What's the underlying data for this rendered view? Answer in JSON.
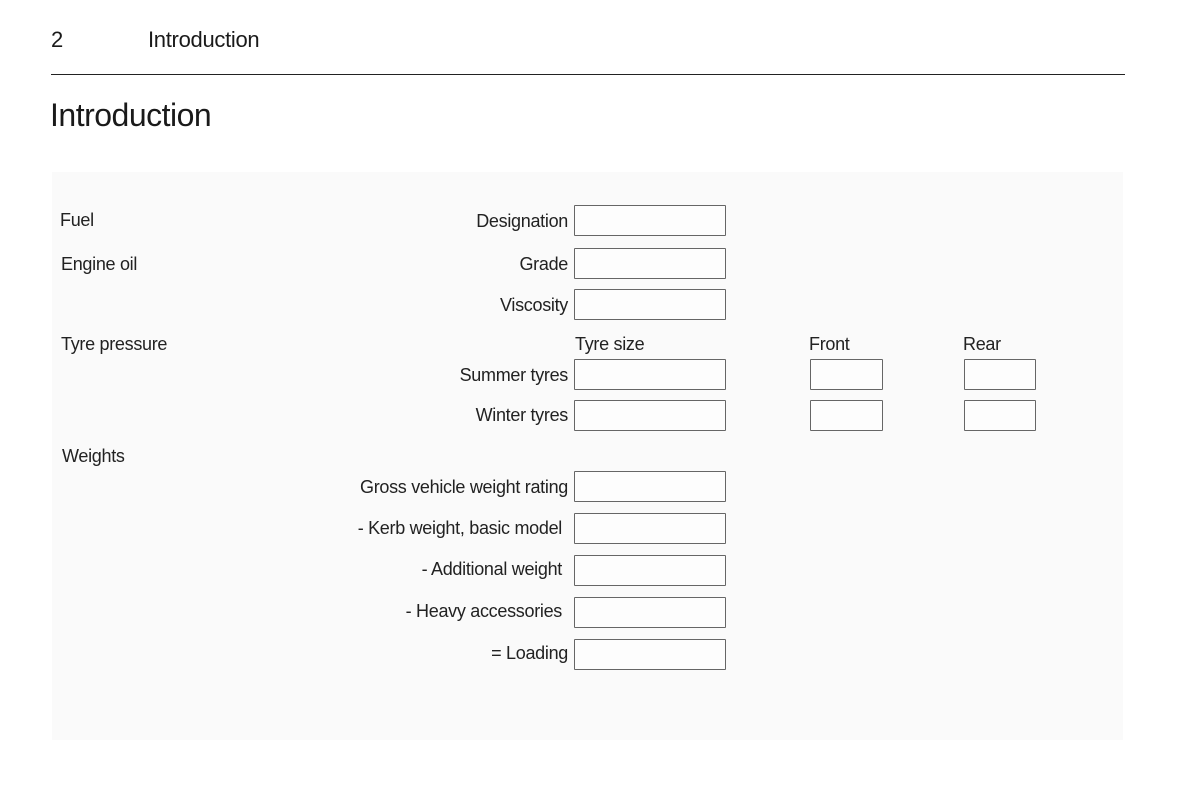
{
  "header": {
    "page_number": "2",
    "running_title": "Introduction"
  },
  "page_title": "Introduction",
  "form": {
    "fuel": {
      "section_label": "Fuel",
      "designation": {
        "label": "Designation",
        "value": ""
      }
    },
    "engine_oil": {
      "section_label": "Engine oil",
      "grade": {
        "label": "Grade",
        "value": ""
      },
      "viscosity": {
        "label": "Viscosity",
        "value": ""
      }
    },
    "tyre_pressure": {
      "section_label": "Tyre pressure",
      "columns": {
        "tyre_size": "Tyre size",
        "front": "Front",
        "rear": "Rear"
      },
      "rows": [
        {
          "label": "Summer tyres",
          "tyre_size": "",
          "front": "",
          "rear": ""
        },
        {
          "label": "Winter tyres",
          "tyre_size": "",
          "front": "",
          "rear": ""
        }
      ]
    },
    "weights": {
      "section_label": "Weights",
      "rows": [
        {
          "label": "Gross vehicle weight rating",
          "value": ""
        },
        {
          "label": "- Kerb weight, basic model",
          "value": ""
        },
        {
          "label": "- Additional weight",
          "value": ""
        },
        {
          "label": "- Heavy accessories",
          "value": ""
        },
        {
          "label": "= Loading",
          "value": ""
        }
      ]
    }
  }
}
